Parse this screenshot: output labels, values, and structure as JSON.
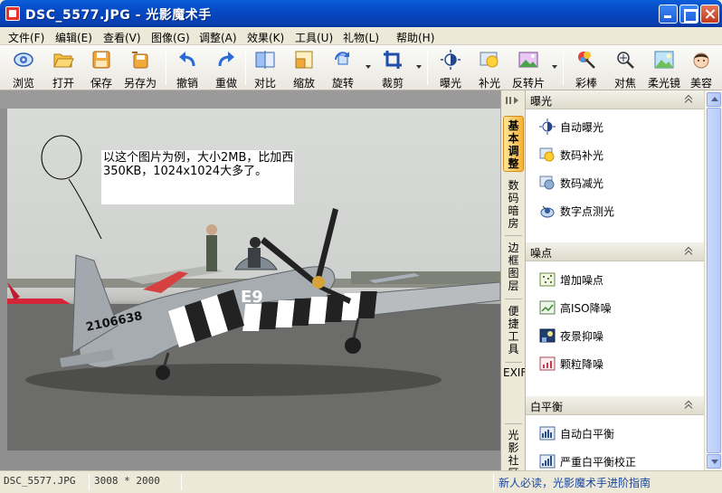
{
  "window": {
    "title": "DSC_5577.JPG - 光影魔术手"
  },
  "menu": [
    "文件(F)",
    "编辑(E)",
    "查看(V)",
    "图像(G)",
    "调整(A)",
    "效果(K)",
    "工具(U)",
    "礼物(L)",
    "帮助(H)"
  ],
  "toolbar": {
    "browse": "浏览",
    "open": "打开",
    "save": "保存",
    "save_as": "另存为",
    "undo": "撤销",
    "redo": "重做",
    "compare": "对比",
    "resize": "缩放",
    "rotate": "旋转",
    "crop": "裁剪",
    "exposure": "曝光",
    "fill_light": "补光",
    "reverse_film": "反转片",
    "color_stick": "彩棒",
    "focus": "对焦",
    "soft_lens": "柔光镜",
    "beauty": "美容"
  },
  "annotation": {
    "text": "以这个图片为例，大小2MB，比加西350KB，1024x1024大多了。"
  },
  "photo": {
    "fuselage_code": "2106638",
    "nose_marking": "E9"
  },
  "side_tabs": [
    "基本调整",
    "数码暗房",
    "边框图层",
    "便捷工具",
    "EXIF",
    "光影社区"
  ],
  "sections": [
    {
      "title": "曝光",
      "items": [
        "自动曝光",
        "数码补光",
        "数码减光",
        "数字点测光"
      ]
    },
    {
      "title": "噪点",
      "items": [
        "增加噪点",
        "高ISO降噪",
        "夜景抑噪",
        "颗粒降噪"
      ]
    },
    {
      "title": "白平衡",
      "items": [
        "自动白平衡",
        "严重白平衡校正"
      ]
    }
  ],
  "status": {
    "filename": "DSC_5577.JPG",
    "dimensions": "3008 * 2000",
    "guide_link": "新人必读，光影魔术手进阶指南"
  }
}
